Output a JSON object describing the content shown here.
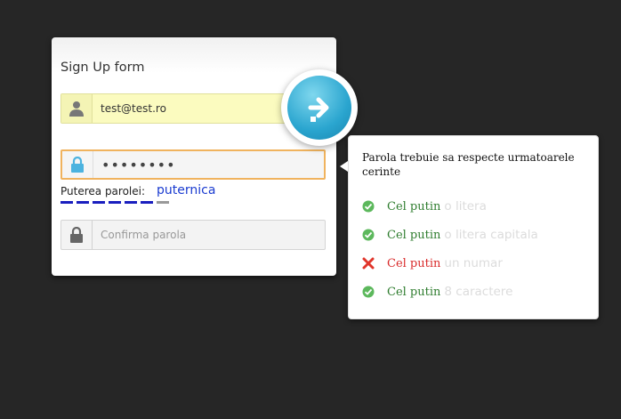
{
  "form": {
    "title": "Sign Up form",
    "email_value": "test@test.ro",
    "password_value": "••••••••",
    "strength_label": "Puterea parolei:",
    "strength_value": "puternica",
    "confirm_placeholder": "Confirma parola"
  },
  "tooltip": {
    "title": "Parola trebuie sa respecte urmatoarele cerinte",
    "requirements": [
      {
        "prefix": "Cel putin",
        "text": "o litera",
        "status": "ok"
      },
      {
        "prefix": "Cel putin",
        "text": "o litera capitala",
        "status": "ok"
      },
      {
        "prefix": "Cel putin",
        "text": "un numar",
        "status": "fail"
      },
      {
        "prefix": "Cel putin",
        "text": "8 caractere",
        "status": "ok"
      }
    ]
  },
  "icons": {
    "email": "user-icon",
    "password": "lock-icon",
    "confirm": "lock-icon",
    "submit": "arrow-right-icon",
    "ok": "check-circle-icon",
    "fail": "x-icon"
  },
  "colors": {
    "background": "#262626",
    "accent": "#2aa5cf",
    "ok": "#2f7d2f",
    "fail": "#d92b2b",
    "strength": "#1a3bd0"
  }
}
